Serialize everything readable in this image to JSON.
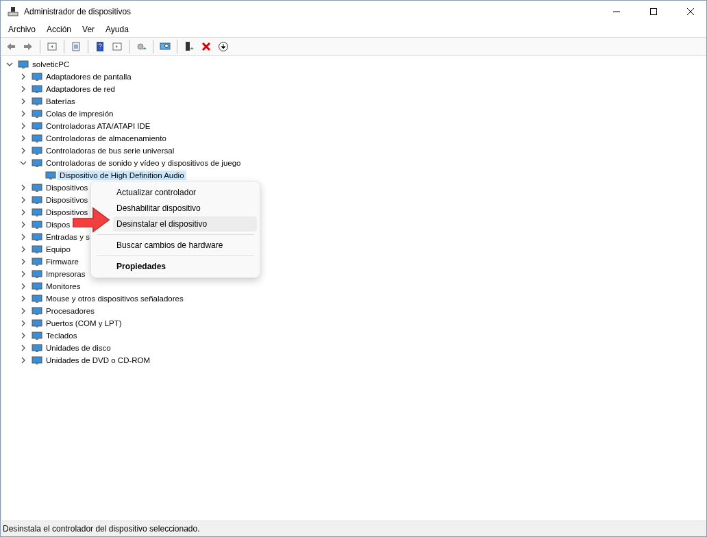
{
  "window": {
    "title": "Administrador de dispositivos"
  },
  "menu_bar": [
    "Archivo",
    "Acción",
    "Ver",
    "Ayuda"
  ],
  "tree": {
    "label": "solveticPC",
    "expanded": true,
    "selected": false,
    "children": [
      {
        "label": "Adaptadores de pantalla",
        "expanded": false,
        "selected": false
      },
      {
        "label": "Adaptadores de red",
        "expanded": false,
        "selected": false
      },
      {
        "label": "Baterías",
        "expanded": false,
        "selected": false
      },
      {
        "label": "Colas de impresión",
        "expanded": false,
        "selected": false
      },
      {
        "label": "Controladoras ATA/ATAPI IDE",
        "expanded": false,
        "selected": false
      },
      {
        "label": "Controladoras de almacenamiento",
        "expanded": false,
        "selected": false
      },
      {
        "label": "Controladoras de bus serie universal",
        "expanded": false,
        "selected": false
      },
      {
        "label": "Controladoras de sonido y vídeo y dispositivos de juego",
        "expanded": true,
        "selected": false,
        "children": [
          {
            "label": "Dispositivo de High Definition Audio",
            "selected": true
          }
        ]
      },
      {
        "label": "Dispositivos",
        "expanded": false,
        "selected": false
      },
      {
        "label": "Dispositivos",
        "expanded": false,
        "selected": false
      },
      {
        "label": "Dispositivos",
        "expanded": false,
        "selected": false
      },
      {
        "label": "Dispos",
        "expanded": false,
        "selected": false
      },
      {
        "label": "Entradas y s",
        "expanded": false,
        "selected": false
      },
      {
        "label": "Equipo",
        "expanded": false,
        "selected": false
      },
      {
        "label": "Firmware",
        "expanded": false,
        "selected": false
      },
      {
        "label": "Impresoras",
        "expanded": false,
        "selected": false
      },
      {
        "label": "Monitores",
        "expanded": false,
        "selected": false
      },
      {
        "label": "Mouse y otros dispositivos señaladores",
        "expanded": false,
        "selected": false
      },
      {
        "label": "Procesadores",
        "expanded": false,
        "selected": false
      },
      {
        "label": "Puertos (COM y LPT)",
        "expanded": false,
        "selected": false
      },
      {
        "label": "Teclados",
        "expanded": false,
        "selected": false
      },
      {
        "label": "Unidades de disco",
        "expanded": false,
        "selected": false
      },
      {
        "label": "Unidades de DVD o CD-ROM",
        "expanded": false,
        "selected": false
      }
    ]
  },
  "context_menu": [
    {
      "kind": "item",
      "label": "Actualizar controlador",
      "selected": false,
      "default": false
    },
    {
      "kind": "item",
      "label": "Deshabilitar dispositivo",
      "selected": false,
      "default": false
    },
    {
      "kind": "item",
      "label": "Desinstalar el dispositivo",
      "selected": true,
      "default": false
    },
    {
      "kind": "separator"
    },
    {
      "kind": "item",
      "label": "Buscar cambios de hardware",
      "selected": false,
      "default": false
    },
    {
      "kind": "separator"
    },
    {
      "kind": "item",
      "label": "Propiedades",
      "selected": false,
      "default": true
    }
  ],
  "status_bar": "Desinstala el controlador del dispositivo seleccionado."
}
